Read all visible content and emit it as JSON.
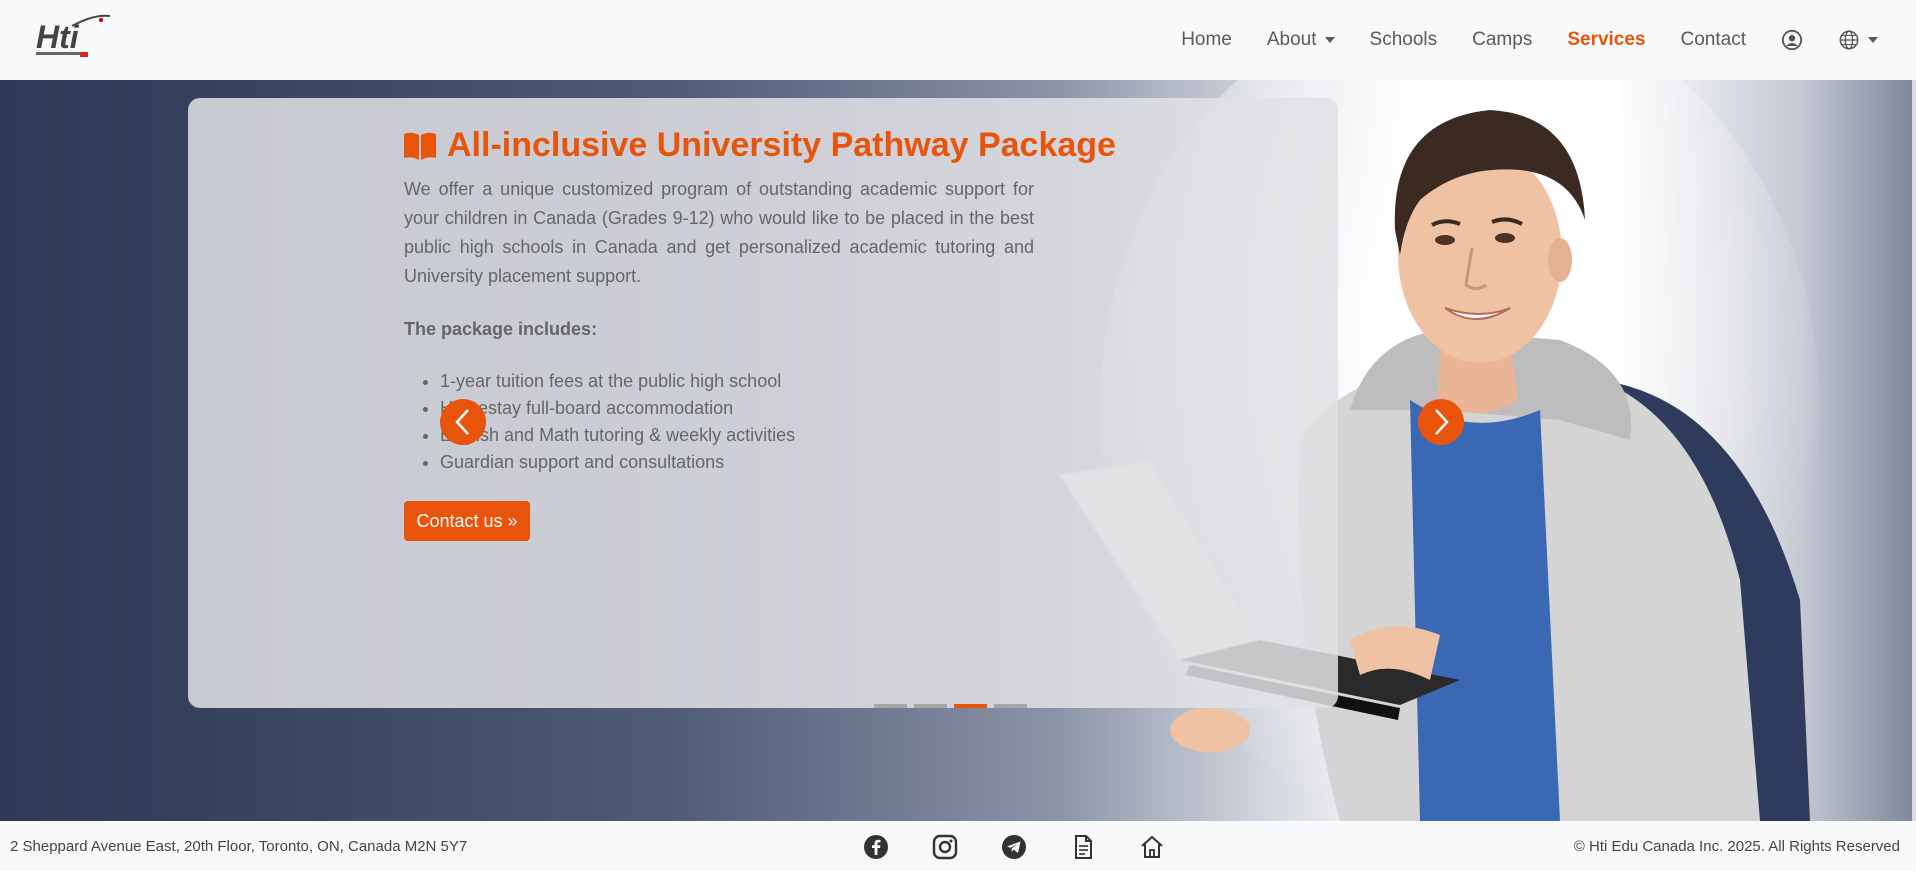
{
  "brand": {
    "logo_alt": "Hti Schools logo"
  },
  "nav": {
    "items": [
      {
        "label": "Home"
      },
      {
        "label": "About"
      },
      {
        "label": "Schools"
      },
      {
        "label": "Camps"
      },
      {
        "label": "Services"
      },
      {
        "label": "Contact"
      }
    ],
    "active": "Services",
    "icons": [
      "user-circle-icon",
      "globe-icon"
    ]
  },
  "slide": {
    "title": "All-inclusive University Pathway Package",
    "description": "We offer a unique customized program of outstanding academic support for your children in Canada (Grades 9-12) who would like to be placed in the best public high schools in Canada and get personalized academic tutoring and University placement support.",
    "subheading": "The package includes:",
    "items": [
      "1-year tuition fees at the public high school",
      "Homestay full-board accommodation",
      "English and Math tutoring & weekly activities",
      "Guardian support and consultations"
    ],
    "button": "Contact us »",
    "indicator_count": 4,
    "active_index": 2
  },
  "footer": {
    "address": "2 Sheppard Avenue East, 20th Floor, Toronto, ON, Canada M2N 5Y7",
    "copyright": "© Hti Edu Canada Inc. 2025. All Rights Reserved",
    "social_icons": [
      "facebook-icon",
      "instagram-icon",
      "telegram-icon",
      "document-icon",
      "home-icon"
    ]
  },
  "colors": {
    "accent": "#e8540c",
    "navbar_bg": "#f8f9fa",
    "hero_dark": "#2e3a57"
  }
}
